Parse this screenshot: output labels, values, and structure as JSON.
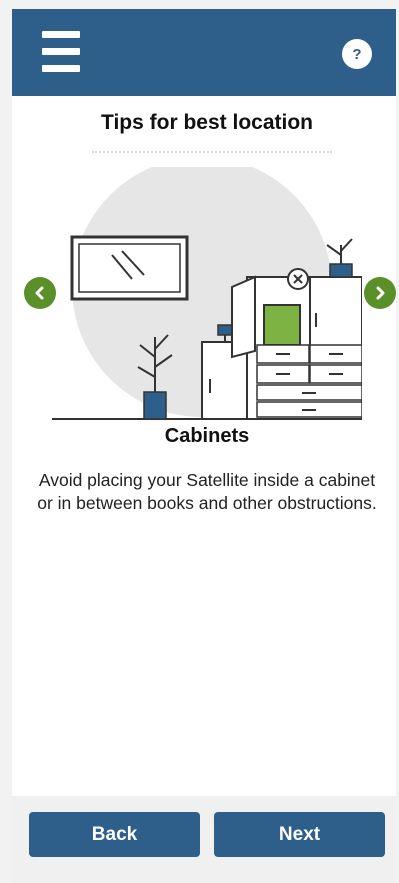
{
  "header": {
    "menu_icon": "hamburger-icon",
    "help_label": "?"
  },
  "page": {
    "title": "Tips for best location",
    "tip_title": "Cabinets",
    "tip_text": "Avoid placing your Satellite inside a cabinet or in between books and other obstructions."
  },
  "nav": {
    "prev_icon": "chevron-left-icon",
    "next_icon": "chevron-right-icon"
  },
  "footer": {
    "back_label": "Back",
    "next_label": "Next"
  },
  "colors": {
    "brand": "#2e5e8a",
    "accent_green": "#5a8f2a",
    "background": "#ffffff"
  }
}
